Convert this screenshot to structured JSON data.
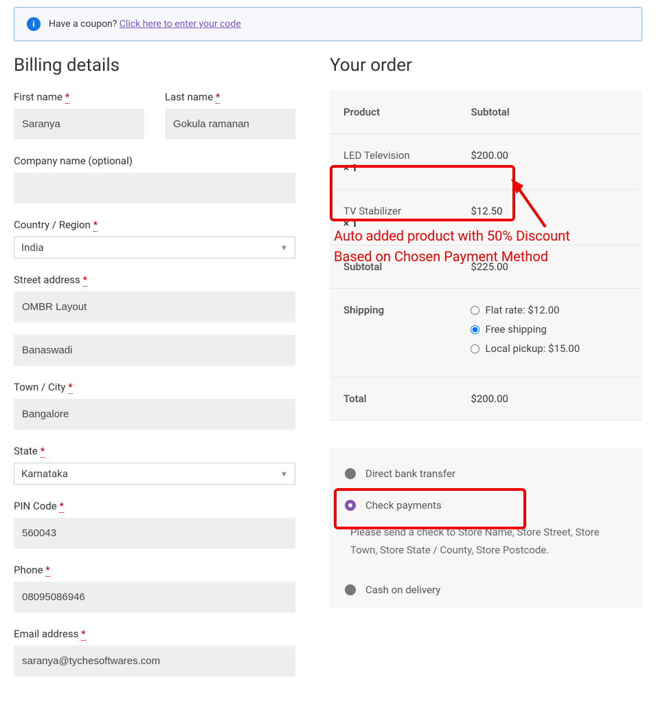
{
  "coupon": {
    "text": "Have a coupon? ",
    "link": "Click here to enter your code"
  },
  "billing": {
    "heading": "Billing details",
    "first_name_label": "First name",
    "first_name": "Saranya",
    "last_name_label": "Last name",
    "last_name": "Gokula ramanan",
    "company_label": "Company name (optional)",
    "company": "",
    "country_label": "Country / Region",
    "country": "India",
    "street_label": "Street address",
    "street1": "OMBR Layout",
    "street2": "Banaswadi",
    "city_label": "Town / City",
    "city": "Bangalore",
    "state_label": "State",
    "state": "Karnataka",
    "pin_label": "PIN Code",
    "pin": "560043",
    "phone_label": "Phone",
    "phone": "08095086946",
    "email_label": "Email address",
    "email": "saranya@tychesoftwares.com"
  },
  "order": {
    "heading": "Your order",
    "col_product": "Product",
    "col_subtotal": "Subtotal",
    "items": [
      {
        "name": "LED Television",
        "qty": "× 1",
        "price": "$200.00"
      },
      {
        "name": "TV Stabilizer",
        "qty": "× 1",
        "price": "$12.50"
      }
    ],
    "subtotal_label": "Subtotal",
    "subtotal": "$225.00",
    "shipping_label": "Shipping",
    "shipping_options": [
      {
        "label": "Flat rate: $12.00",
        "selected": false
      },
      {
        "label": "Free shipping",
        "selected": true
      },
      {
        "label": "Local pickup: $15.00",
        "selected": false
      }
    ],
    "total_label": "Total",
    "total": "$200.00"
  },
  "payment": {
    "options": [
      {
        "label": "Direct bank transfer",
        "selected": false
      },
      {
        "label": "Check payments",
        "selected": true
      },
      {
        "label": "Cash on delivery",
        "selected": false
      }
    ],
    "check_desc": "Please send a check to Store Name, Store Street, Store Town, Store State / County, Store Postcode."
  },
  "annotation": {
    "line1": "Auto added product with 50% Discount",
    "line2": "Based on Chosen Payment Method"
  }
}
